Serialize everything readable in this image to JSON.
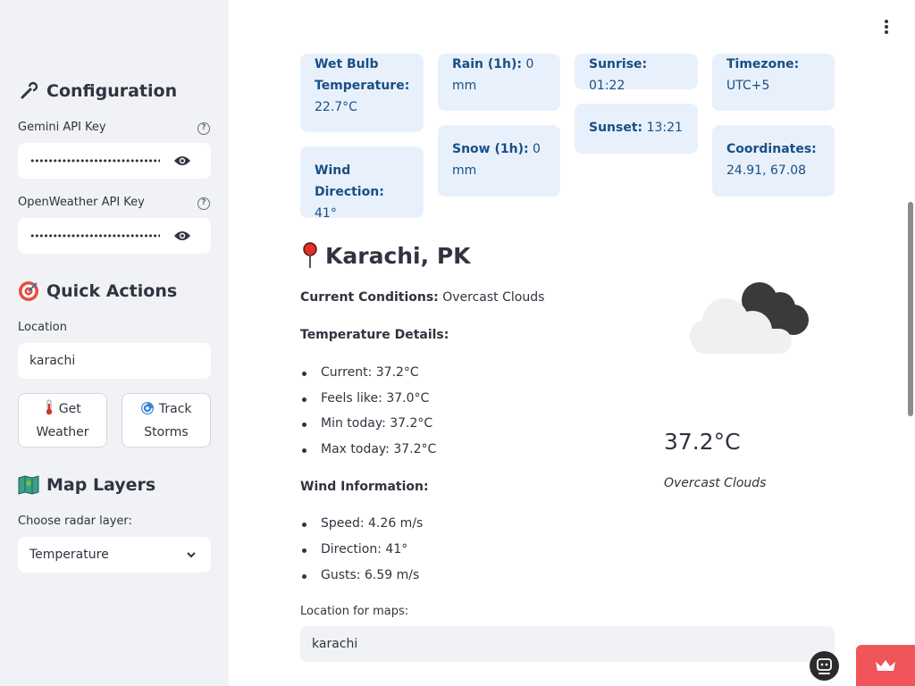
{
  "sidebar": {
    "configuration": {
      "title": "Configuration",
      "icon": "wrench-icon"
    },
    "gemini": {
      "label": "Gemini API Key",
      "value": "••••••••••••••••••••••••••••••••••••"
    },
    "openweather": {
      "label": "OpenWeather API Key",
      "value": "••••••••••••••••••••••••••••••••••••"
    },
    "help_glyph": "?",
    "quick_actions": {
      "title": "Quick Actions",
      "icon": "target-icon"
    },
    "location": {
      "label": "Location",
      "value": "karachi"
    },
    "buttons": {
      "get_weather": "Get Weather",
      "track_storms": "Track Storms"
    },
    "map_layers": {
      "title": "Map Layers",
      "icon": "map-icon"
    },
    "radar": {
      "label": "Choose radar layer:",
      "selected": "Temperature"
    }
  },
  "cards": {
    "wet_bulb": {
      "key": "Wet Bulb Temperature:",
      "value": "22.7°C"
    },
    "wind_direction": {
      "key": "Wind Direction:",
      "value": "41°"
    },
    "rain": {
      "key": "Rain (1h):",
      "value": "0 mm"
    },
    "snow": {
      "key": "Snow (1h):",
      "value": "0 mm"
    },
    "sunrise": {
      "key": "Sunrise:",
      "value": "01:22"
    },
    "sunset": {
      "key": "Sunset:",
      "value": "13:21"
    },
    "timezone": {
      "key": "Timezone:",
      "value": "UTC+5"
    },
    "coordinates": {
      "key": "Coordinates:",
      "value": "24.91, 67.08"
    }
  },
  "main": {
    "city": "Karachi, PK",
    "current_conditions_key": "Current Conditions:",
    "current_conditions_value": "Overcast Clouds",
    "temperature_heading": "Temperature Details:",
    "temperature_items": [
      "Current: 37.2°C",
      "Feels like: 37.0°C",
      "Min today: 37.2°C",
      "Max today: 37.2°C"
    ],
    "wind_heading": "Wind Information:",
    "wind_items": [
      "Speed: 4.26 m/s",
      "Direction: 41°",
      "Gusts: 6.59 m/s"
    ],
    "big_temp": "37.2°C",
    "condition": "Overcast Clouds",
    "map_location_label": "Location for maps:",
    "map_location_value": "karachi"
  },
  "colors": {
    "sidebar_bg": "#f0f2f6",
    "card_bg": "#e8f1fb",
    "card_text": "#1a4e85",
    "accent": "#f0555a"
  }
}
